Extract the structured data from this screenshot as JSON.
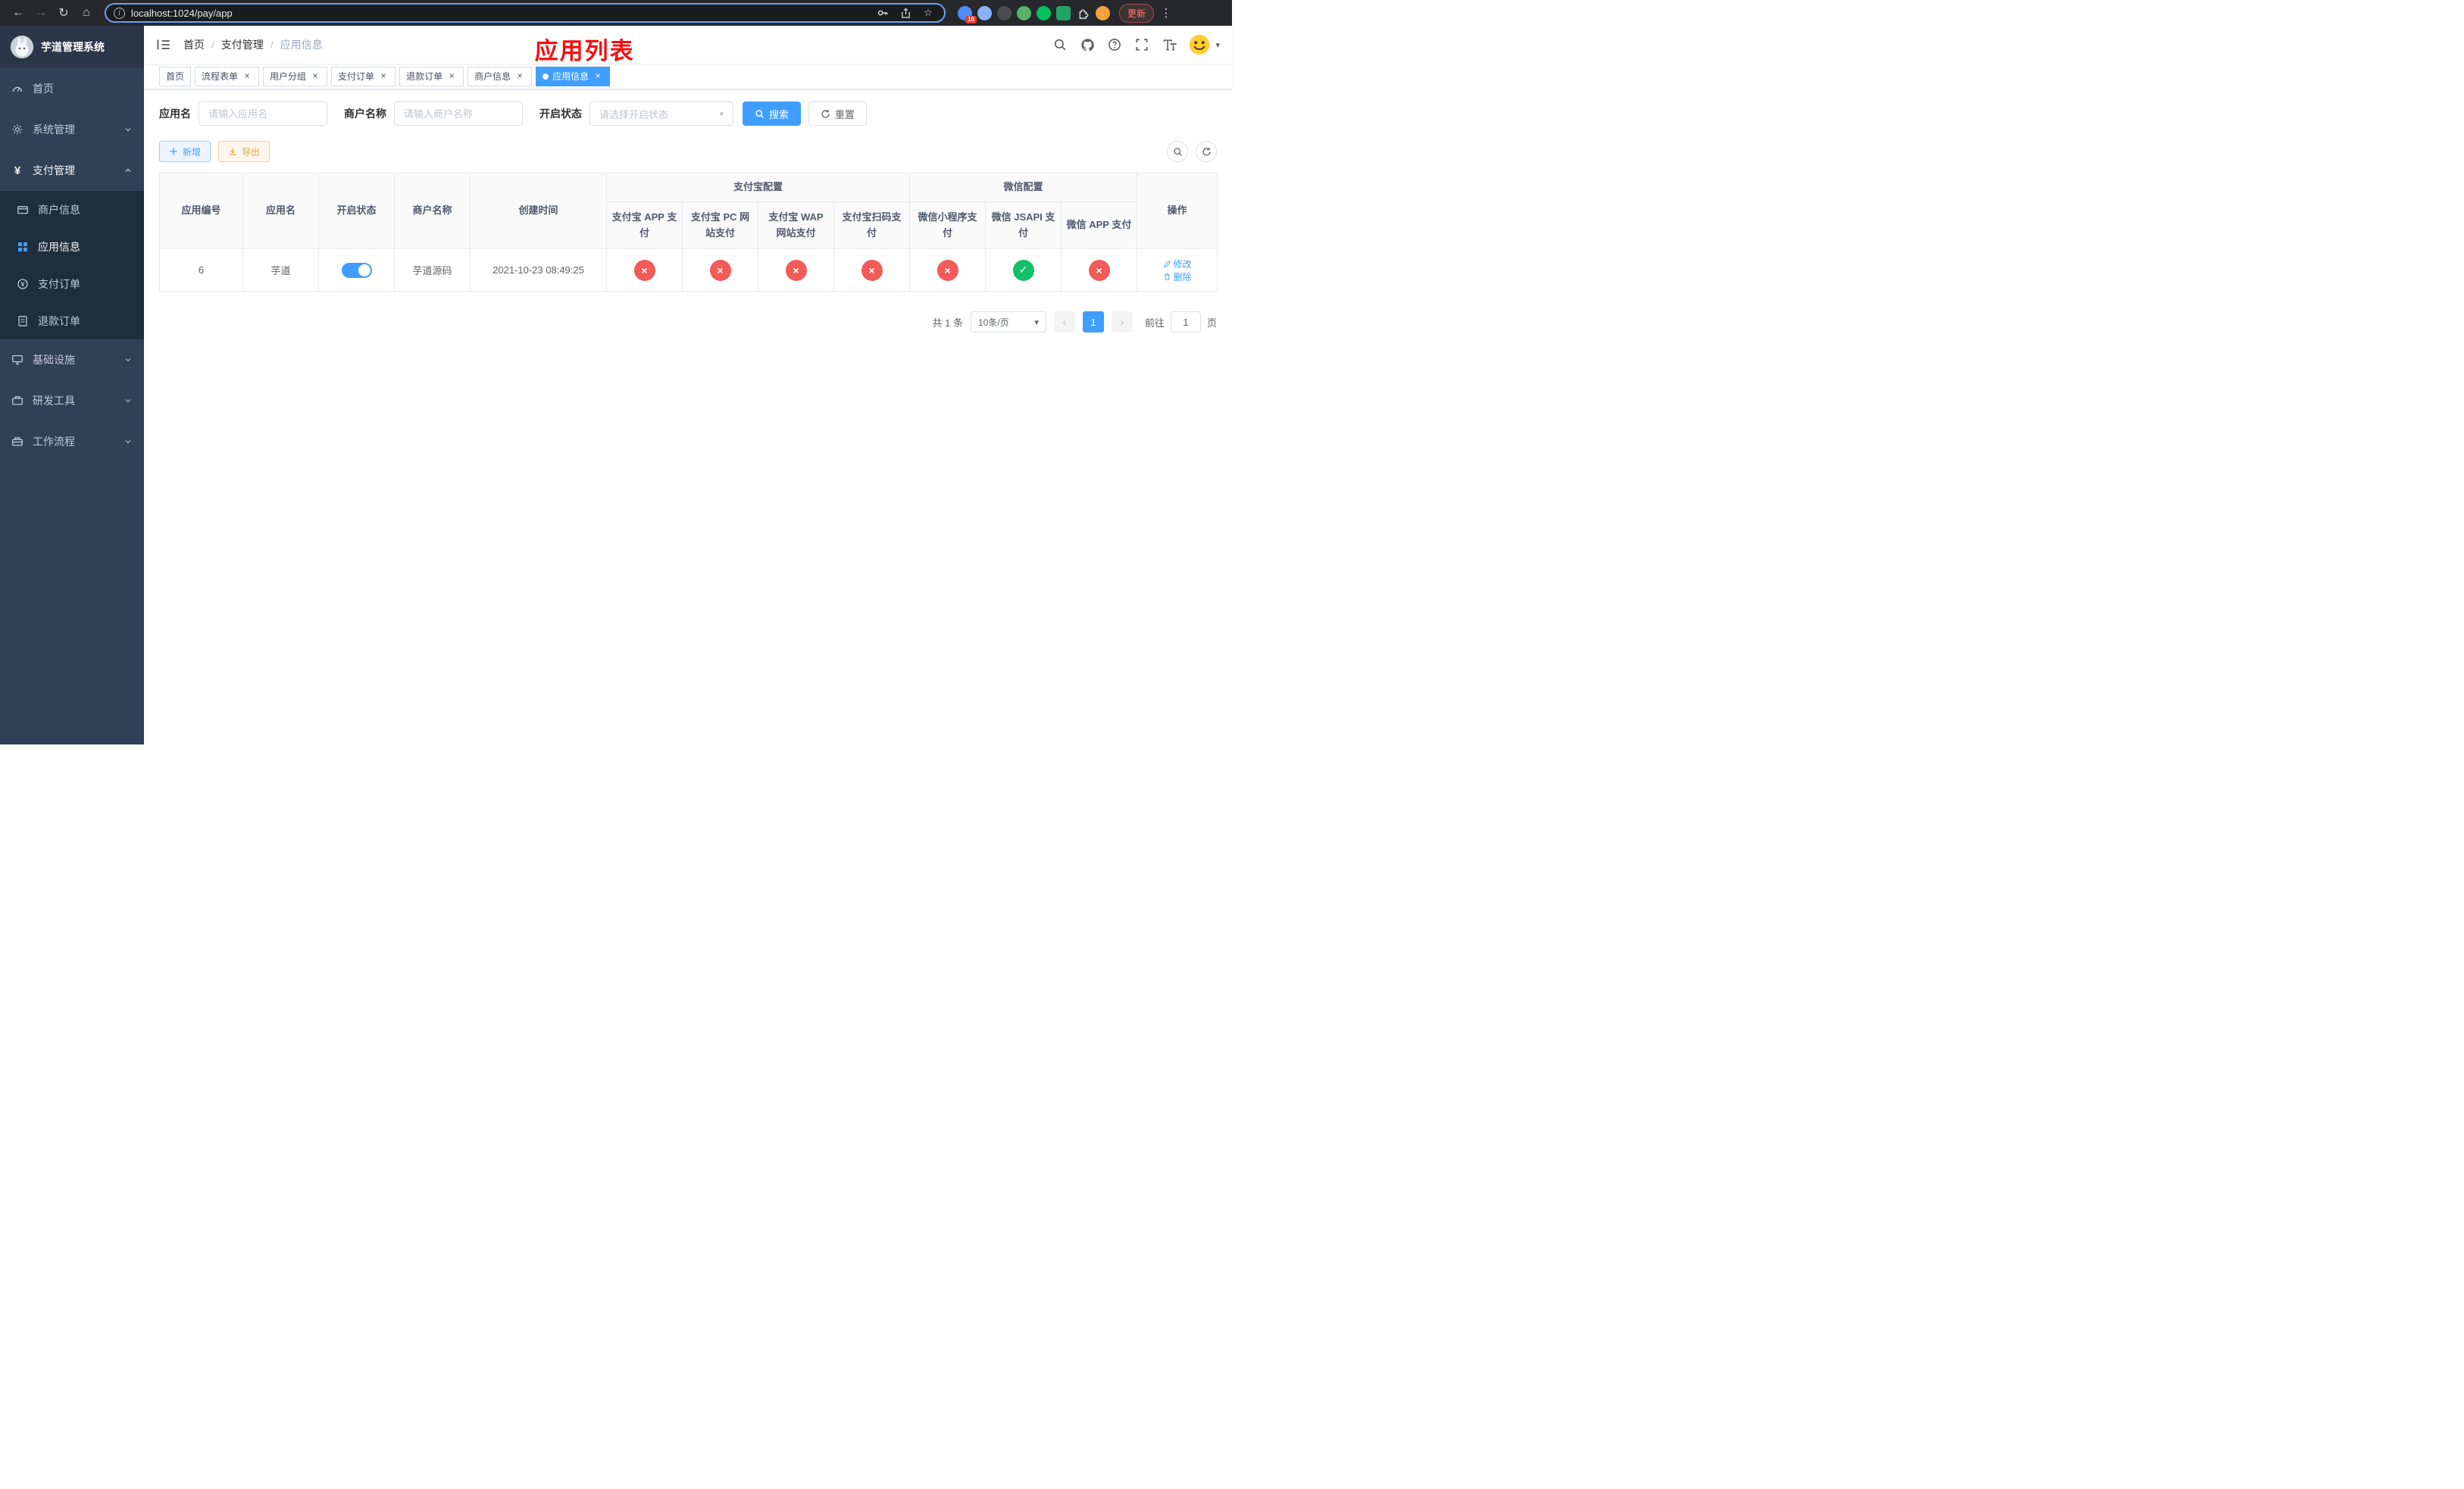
{
  "browser": {
    "url": "localhost:1024/pay/app",
    "update_label": "更新",
    "extension_badge": "10"
  },
  "icons": {
    "back": "←",
    "forward": "→",
    "reload": "↻",
    "home": "⌂",
    "star": "☆",
    "dots": "⋮",
    "close": "×",
    "caret": "▾",
    "yen": "¥",
    "info": "i",
    "check": "✓",
    "cross": "×",
    "prev": "‹",
    "next": "›",
    "slash": "/"
  },
  "sidebar": {
    "title": "芋道管理系统",
    "items": {
      "home": "首页",
      "system": "系统管理",
      "pay": "支付管理",
      "infra": "基础设施",
      "devtools": "研发工具",
      "workflow": "工作流程"
    },
    "pay_children": {
      "merchant": "商户信息",
      "app": "应用信息",
      "order": "支付订单",
      "refund": "退款订单"
    }
  },
  "header": {
    "breadcrumb": {
      "home": "首页",
      "section": "支付管理",
      "current": "应用信息"
    },
    "annotation": "应用列表"
  },
  "tabs": [
    {
      "label": "首页"
    },
    {
      "label": "流程表单"
    },
    {
      "label": "用户分组"
    },
    {
      "label": "支付订单"
    },
    {
      "label": "退款订单"
    },
    {
      "label": "商户信息"
    },
    {
      "label": "应用信息"
    }
  ],
  "filters": {
    "app_name": {
      "label": "应用名",
      "placeholder": "请输入应用名"
    },
    "merchant": {
      "label": "商户名称",
      "placeholder": "请输入商户名称"
    },
    "status": {
      "label": "开启状态",
      "placeholder": "请选择开启状态"
    },
    "search": "搜索",
    "reset": "重置"
  },
  "toolbar": {
    "add": "新增",
    "export": "导出"
  },
  "table": {
    "headers": {
      "app_id": "应用编号",
      "app_name": "应用名",
      "status": "开启状态",
      "merchant": "商户名称",
      "created": "创建时间",
      "alipay_group": "支付宝配置",
      "wechat_group": "微信配置",
      "alipay_app": "支付宝 APP 支付",
      "alipay_pc": "支付宝 PC 网站支付",
      "alipay_wap": "支付宝 WAP 网站支付",
      "alipay_qr": "支付宝扫码支付",
      "wx_lite": "微信小程序支付",
      "wx_jsapi": "微信 JSAPI 支付",
      "wx_app": "微信 APP 支付",
      "actions": "操作"
    },
    "row": {
      "id": "6",
      "app_name": "芋道",
      "status_on": true,
      "merchant": "芋道源码",
      "created": "2021-10-23 08:49:25",
      "alipay_app": false,
      "alipay_pc": false,
      "alipay_wap": false,
      "alipay_qr": false,
      "wx_lite": false,
      "wx_jsapi": true,
      "wx_app": false,
      "edit": "修改",
      "delete": "删除"
    }
  },
  "pagination": {
    "total": "共 1 条",
    "page_size": "10条/页",
    "page": "1",
    "goto": "前往",
    "goto_value": "1",
    "unit": "页"
  }
}
